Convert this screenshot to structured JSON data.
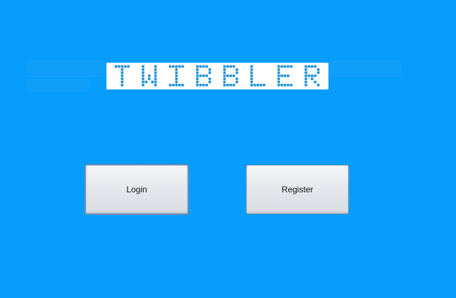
{
  "app": {
    "logo_text": "TWIBBLER"
  },
  "buttons": {
    "login_label": "Login",
    "register_label": "Register"
  },
  "colors": {
    "background": "#069dfd",
    "logo_background": "#ffffff",
    "logo_pixel": "#1a8fd6"
  }
}
